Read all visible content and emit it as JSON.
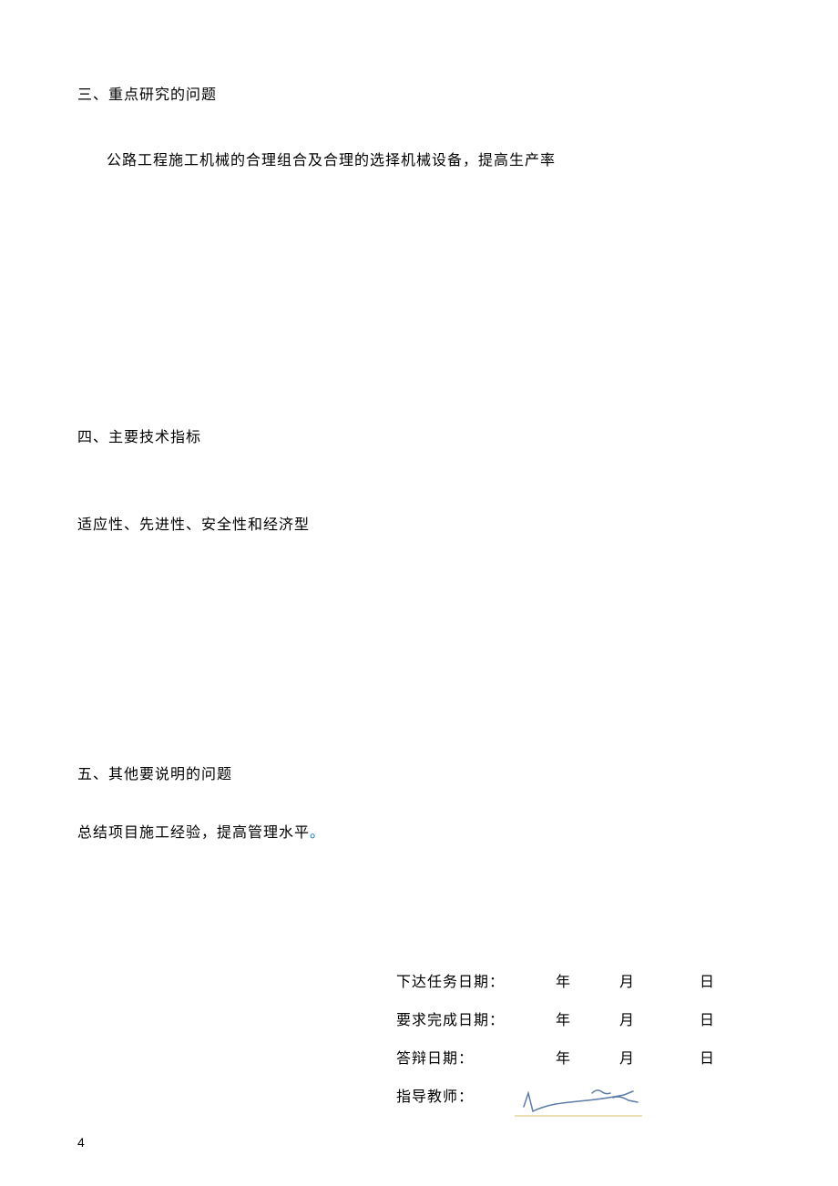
{
  "section3": {
    "heading": "三、重点研究的问题",
    "content": "公路工程施工机械的合理组合及合理的选择机械设备，提高生产率"
  },
  "section4": {
    "heading": "四、主要技术指标",
    "content": "适应性、先进性、安全性和经济型"
  },
  "section5": {
    "heading": "五、其他要说明的问题",
    "content": "总结项目施工经验，提高管理水平",
    "period": "。"
  },
  "dates": {
    "task_date_label": "下达任务日期：",
    "completion_date_label": "要求完成日期：",
    "defense_date_label": "答辩日期：",
    "advisor_label": "指导教师：",
    "year_unit": "年",
    "month_unit": "月",
    "day_unit": "日"
  },
  "page_number": "4"
}
